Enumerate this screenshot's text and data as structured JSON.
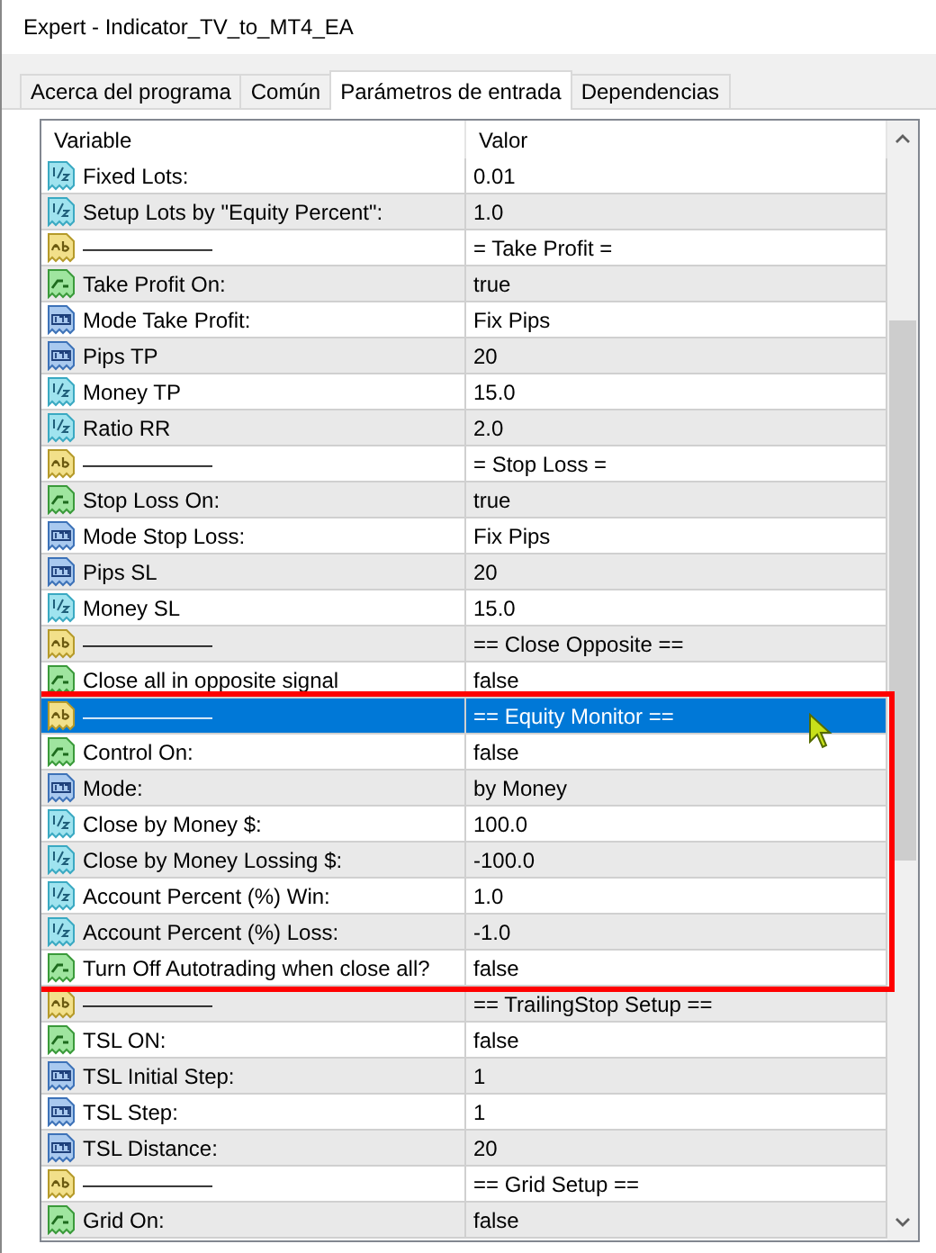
{
  "window": {
    "title": "Expert - Indicator_TV_to_MT4_EA"
  },
  "tabs": [
    {
      "label": "Acerca del programa",
      "selected": false
    },
    {
      "label": "Común",
      "selected": false
    },
    {
      "label": "Parámetros de entrada",
      "selected": true
    },
    {
      "label": "Dependencias",
      "selected": false
    }
  ],
  "table": {
    "columns": [
      "Variable",
      "Valor"
    ],
    "rows": [
      {
        "kind": "double",
        "variable": "Fixed Lots:",
        "value": "0.01",
        "selected": false,
        "highlighted": false
      },
      {
        "kind": "double",
        "variable": "Setup Lots by \"Equity Percent\":",
        "value": "1.0",
        "selected": false,
        "highlighted": false
      },
      {
        "kind": "string",
        "variable": "——————",
        "value": "= Take Profit =",
        "selected": false,
        "highlighted": false
      },
      {
        "kind": "bool",
        "variable": "Take Profit On:",
        "value": "true",
        "selected": false,
        "highlighted": false
      },
      {
        "kind": "int",
        "variable": "Mode Take Profit:",
        "value": "Fix Pips",
        "selected": false,
        "highlighted": false
      },
      {
        "kind": "int",
        "variable": "Pips TP",
        "value": "20",
        "selected": false,
        "highlighted": false
      },
      {
        "kind": "double",
        "variable": "Money TP",
        "value": "15.0",
        "selected": false,
        "highlighted": false
      },
      {
        "kind": "double",
        "variable": "Ratio RR",
        "value": "2.0",
        "selected": false,
        "highlighted": false
      },
      {
        "kind": "string",
        "variable": "——————",
        "value": "= Stop Loss =",
        "selected": false,
        "highlighted": false
      },
      {
        "kind": "bool",
        "variable": "Stop Loss On:",
        "value": "true",
        "selected": false,
        "highlighted": false
      },
      {
        "kind": "int",
        "variable": "Mode Stop Loss:",
        "value": "Fix Pips",
        "selected": false,
        "highlighted": false
      },
      {
        "kind": "int",
        "variable": "Pips SL",
        "value": "20",
        "selected": false,
        "highlighted": false
      },
      {
        "kind": "double",
        "variable": "Money SL",
        "value": "15.0",
        "selected": false,
        "highlighted": false
      },
      {
        "kind": "string",
        "variable": "——————",
        "value": "== Close Opposite ==",
        "selected": false,
        "highlighted": false
      },
      {
        "kind": "bool",
        "variable": "Close all in opposite signal",
        "value": "false",
        "selected": false,
        "highlighted": false
      },
      {
        "kind": "string",
        "variable": "——————",
        "value": "== Equity Monitor ==",
        "selected": true,
        "highlighted": true
      },
      {
        "kind": "bool",
        "variable": "Control On:",
        "value": "false",
        "selected": false,
        "highlighted": true
      },
      {
        "kind": "int",
        "variable": "Mode:",
        "value": "by Money",
        "selected": false,
        "highlighted": true
      },
      {
        "kind": "double",
        "variable": "Close by Money $:",
        "value": "100.0",
        "selected": false,
        "highlighted": true
      },
      {
        "kind": "double",
        "variable": "Close by Money Lossing $:",
        "value": "-100.0",
        "selected": false,
        "highlighted": true
      },
      {
        "kind": "double",
        "variable": "Account Percent (%) Win:",
        "value": "1.0",
        "selected": false,
        "highlighted": true
      },
      {
        "kind": "double",
        "variable": "Account Percent (%) Loss:",
        "value": "-1.0",
        "selected": false,
        "highlighted": true
      },
      {
        "kind": "bool",
        "variable": "Turn Off Autotrading when close all?",
        "value": "false",
        "selected": false,
        "highlighted": true
      },
      {
        "kind": "string",
        "variable": "——————",
        "value": "== TrailingStop Setup ==",
        "selected": false,
        "highlighted": false
      },
      {
        "kind": "bool",
        "variable": "TSL ON:",
        "value": "false",
        "selected": false,
        "highlighted": false
      },
      {
        "kind": "int",
        "variable": "TSL Initial Step:",
        "value": "1",
        "selected": false,
        "highlighted": false
      },
      {
        "kind": "int",
        "variable": "TSL Step:",
        "value": "1",
        "selected": false,
        "highlighted": false
      },
      {
        "kind": "int",
        "variable": "TSL Distance:",
        "value": "20",
        "selected": false,
        "highlighted": false
      },
      {
        "kind": "string",
        "variable": "——————",
        "value": "== Grid Setup ==",
        "selected": false,
        "highlighted": false
      },
      {
        "kind": "bool",
        "variable": "Grid On:",
        "value": "false",
        "selected": false,
        "highlighted": false
      }
    ]
  }
}
